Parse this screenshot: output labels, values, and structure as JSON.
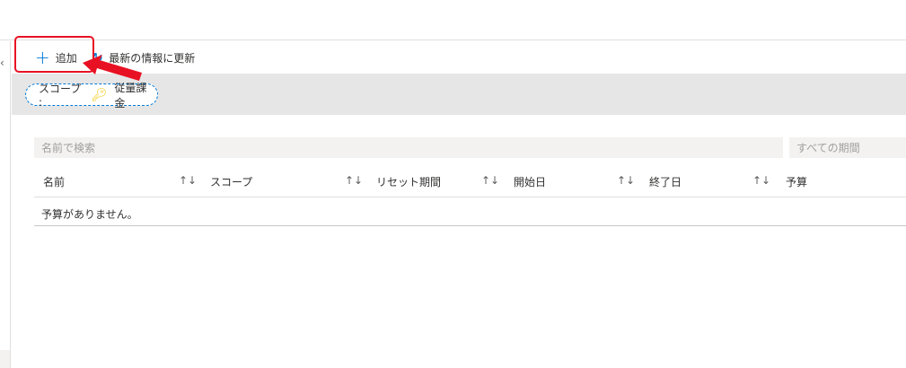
{
  "toolbar": {
    "add_label": "追加",
    "refresh_label": "最新の情報に更新"
  },
  "filter": {
    "scope_label": "スコープ :",
    "scope_value": "従量課金"
  },
  "search": {
    "placeholder": "名前で検索",
    "period": "すべての期間"
  },
  "table": {
    "columns": [
      "名前",
      "スコープ",
      "リセット期間",
      "開始日",
      "終了日",
      "予算"
    ],
    "sort_glyph": "↑↓",
    "empty": "予算がありません。"
  },
  "colors": {
    "accent": "#0078d4",
    "annotation": "#e81123"
  }
}
